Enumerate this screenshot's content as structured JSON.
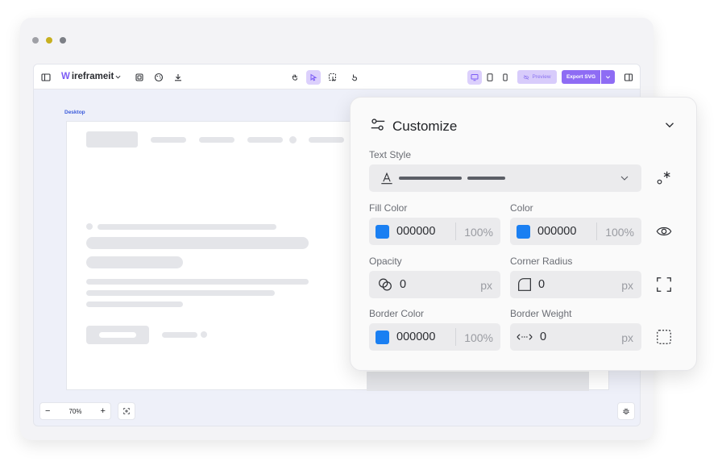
{
  "window": {
    "dots": [
      "#9fa0a6",
      "#c7b020",
      "#7c7f86"
    ]
  },
  "toolbar": {
    "brand_prefix": "W",
    "brand_rest": "ireframeit",
    "preview_label": "Preview",
    "export_label": "Export SVG"
  },
  "canvas": {
    "frame_label": "Desktop"
  },
  "zoom": {
    "minus": "−",
    "value": "70%",
    "plus": "+"
  },
  "panel": {
    "title": "Customize",
    "text_style_label": "Text Style",
    "fill_color_label": "Fill Color",
    "fill_color_hex": "000000",
    "fill_color_opacity": "100%",
    "color_label": "Color",
    "color_hex": "000000",
    "color_opacity": "100%",
    "opacity_label": "Opacity",
    "opacity_value": "0",
    "opacity_unit": "px",
    "corner_radius_label": "Corner Radius",
    "corner_radius_value": "0",
    "corner_radius_unit": "px",
    "border_color_label": "Border Color",
    "border_color_hex": "000000",
    "border_color_opacity": "100%",
    "border_weight_label": "Border Weight",
    "border_weight_value": "0",
    "border_weight_unit": "px"
  },
  "colors": {
    "accent": "#8e6cf4",
    "swatch": "#1a7ff2"
  }
}
